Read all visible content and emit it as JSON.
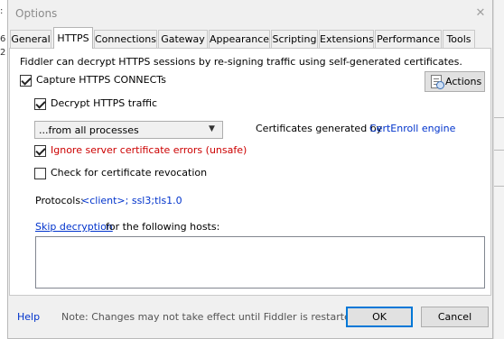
{
  "window": {
    "title": "Options"
  },
  "tabs": [
    {
      "label": "General"
    },
    {
      "label": "HTTPS"
    },
    {
      "label": "Connections"
    },
    {
      "label": "Gateway"
    },
    {
      "label": "Appearance"
    },
    {
      "label": "Scripting"
    },
    {
      "label": "Extensions"
    },
    {
      "label": "Performance"
    },
    {
      "label": "Tools"
    }
  ],
  "https": {
    "intro": "Fiddler can decrypt HTTPS sessions by re-signing traffic using self-generated certificates.",
    "capture_connects": {
      "label": "Capture HTTPS CONNECTs",
      "checked": true
    },
    "actions_label": "Actions",
    "decrypt_traffic": {
      "label": "Decrypt HTTPS traffic",
      "checked": true
    },
    "process_filter": {
      "selected": "...from all processes"
    },
    "cert_info_prefix": "Certificates generated by",
    "cert_engine_link": "CertEnroll engine",
    "ignore_errors": {
      "label": "Ignore server certificate errors (unsafe)",
      "checked": true
    },
    "check_revocation": {
      "label": "Check for certificate revocation",
      "checked": false
    },
    "protocols_label": "Protocols:",
    "protocols_value": "<client>; ssl3;tls1.0",
    "skip_link": "Skip decryption",
    "skip_suffix": "for the following hosts:",
    "skip_hosts_value": ""
  },
  "footer": {
    "help": "Help",
    "note": "Note: Changes may not take effect until Fiddler is restarted.",
    "ok": "OK",
    "cancel": "Cancel"
  }
}
